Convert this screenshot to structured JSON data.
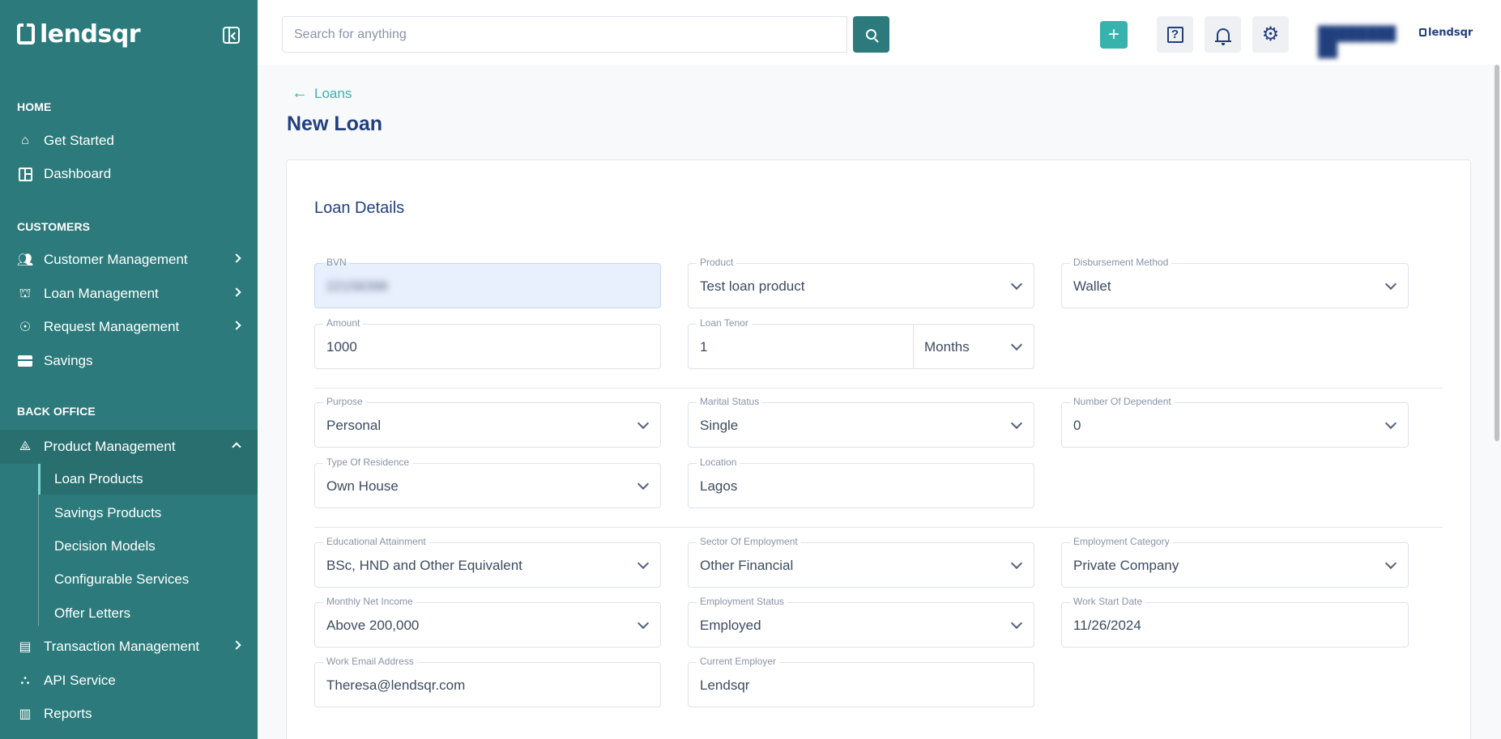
{
  "brand": {
    "name": "lendsqr"
  },
  "sidebar": {
    "sections": {
      "home": "HOME",
      "customers": "CUSTOMERS",
      "back_office": "BACK OFFICE"
    },
    "home_items": [
      {
        "label": "Get Started",
        "icon": "home-icon"
      },
      {
        "label": "Dashboard",
        "icon": "dashboard-icon"
      }
    ],
    "customer_items": [
      {
        "label": "Customer Management",
        "icon": "users-icon"
      },
      {
        "label": "Loan Management",
        "icon": "bank-icon"
      },
      {
        "label": "Request Management",
        "icon": "hand-coins-icon"
      },
      {
        "label": "Savings",
        "icon": "briefcase-icon"
      }
    ],
    "back_office_items": [
      {
        "label": "Product Management",
        "icon": "shapes-icon",
        "expanded": true
      },
      {
        "label": "Transaction Management",
        "icon": "document-icon"
      },
      {
        "label": "API Service",
        "icon": "institution-icon"
      },
      {
        "label": "Reports",
        "icon": "report-icon"
      }
    ],
    "product_sub_items": [
      {
        "label": "Loan Products",
        "selected": true
      },
      {
        "label": "Savings Products"
      },
      {
        "label": "Decision Models"
      },
      {
        "label": "Configurable Services"
      },
      {
        "label": "Offer Letters"
      }
    ]
  },
  "topbar": {
    "search_placeholder": "Search for anything",
    "plus": "+",
    "help": "?",
    "user_logo": "lendsqr"
  },
  "main": {
    "back_label": "Loans",
    "page_title": "New Loan",
    "card_title": "Loan Details",
    "fields": {
      "bvn": {
        "label": "BVN",
        "value": "22158398"
      },
      "product": {
        "label": "Product",
        "value": "Test loan product"
      },
      "disbursement": {
        "label": "Disbursement Method",
        "value": "Wallet"
      },
      "amount": {
        "label": "Amount",
        "value": "1000"
      },
      "tenor": {
        "label": "Loan Tenor",
        "value": "1",
        "unit": "Months"
      },
      "purpose": {
        "label": "Purpose",
        "value": "Personal"
      },
      "marital": {
        "label": "Marital Status",
        "value": "Single"
      },
      "dependents": {
        "label": "Number Of Dependent",
        "value": "0"
      },
      "residence": {
        "label": "Type Of Residence",
        "value": "Own House"
      },
      "location": {
        "label": "Location",
        "value": "Lagos"
      },
      "education": {
        "label": "Educational Attainment",
        "value": "BSc, HND and Other Equivalent"
      },
      "sector": {
        "label": "Sector Of Employment",
        "value": "Other Financial"
      },
      "emp_category": {
        "label": "Employment Category",
        "value": "Private Company"
      },
      "income": {
        "label": "Monthly Net Income",
        "value": "Above 200,000"
      },
      "emp_status": {
        "label": "Employment Status",
        "value": "Employed"
      },
      "work_start": {
        "label": "Work Start Date",
        "value": "11/26/2024"
      },
      "work_email": {
        "label": "Work Email Address",
        "value": "Theresa@lendsqr.com"
      },
      "employer": {
        "label": "Current Employer",
        "value": "Lendsqr"
      }
    }
  },
  "colors": {
    "sidebar": "#2c7a7b",
    "accent": "#38b2ac",
    "text": "#213f7d"
  }
}
